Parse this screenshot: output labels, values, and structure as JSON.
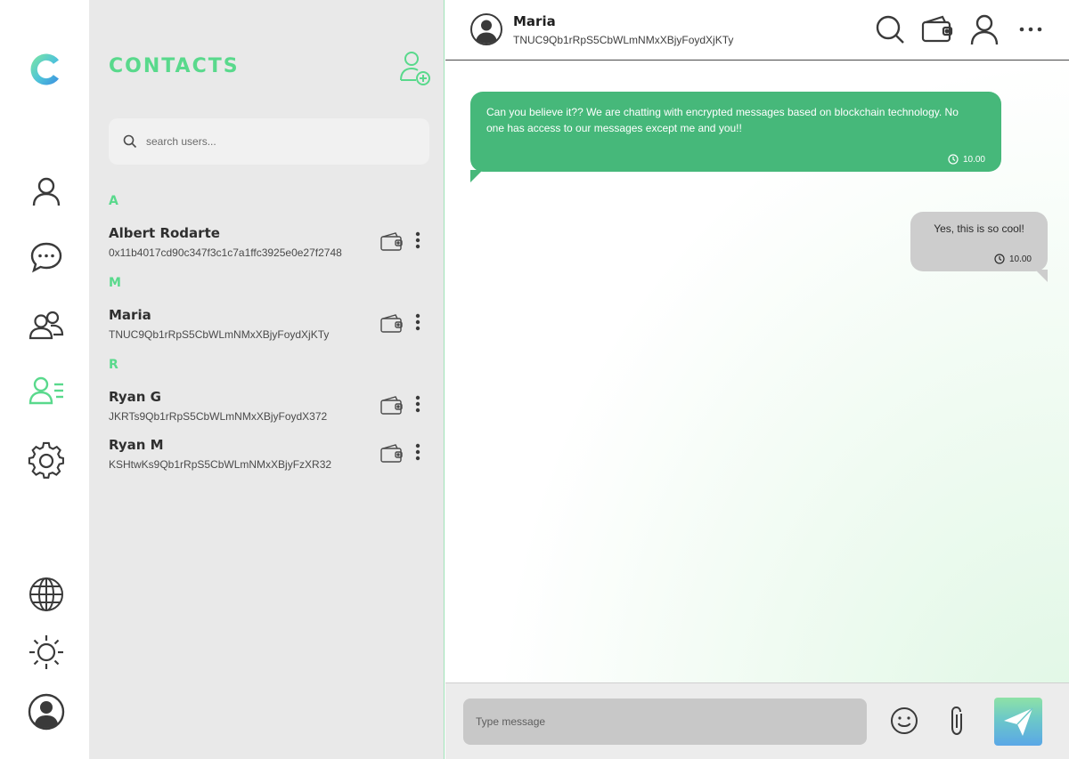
{
  "brand": {
    "logo_icon": "c-logo-icon",
    "accent": "#59d98c",
    "dark_green": "#46b87a"
  },
  "rail": {
    "items": [
      {
        "icon": "user-icon"
      },
      {
        "icon": "chat-bubble-icon"
      },
      {
        "icon": "group-icon"
      },
      {
        "icon": "contacts-list-icon",
        "active": true
      },
      {
        "icon": "gear-icon"
      },
      {
        "icon": "globe-icon"
      },
      {
        "icon": "sun-icon"
      },
      {
        "icon": "profile-avatar-icon"
      }
    ]
  },
  "contacts": {
    "title": "CONTACTS",
    "add_icon": "add-user-icon",
    "search": {
      "placeholder": "search users..."
    },
    "groups": [
      {
        "letter": "A",
        "items": [
          {
            "name": "Albert Rodarte",
            "address": "0x11b4017cd90c347f3c1c7a1ffc3925e0e27f2748"
          }
        ]
      },
      {
        "letter": "M",
        "items": [
          {
            "name": "Maria",
            "address": "TNUC9Qb1rRpS5CbWLmNMxXBjyFoydXjKTy"
          }
        ]
      },
      {
        "letter": "R",
        "items": [
          {
            "name": "Ryan G",
            "address": "JKRTs9Qb1rRpS5CbWLmNMxXBjyFoydX372"
          },
          {
            "name": "Ryan M",
            "address": "KSHtwKs9Qb1rRpS5CbWLmNMxXBjyFzXR32"
          }
        ]
      }
    ]
  },
  "chat": {
    "header": {
      "name": "Maria",
      "address": "TNUC9Qb1rRpS5CbWLmNMxXBjyFoydXjKTy"
    },
    "messages": [
      {
        "direction": "incoming",
        "text": "Can you believe it?? We are chatting with encrypted messages based on blockchain technology. No one has access to our messages except me and you!!",
        "time": "10.00"
      },
      {
        "direction": "outgoing",
        "text": "Yes, this is so cool!",
        "time": "10.00"
      }
    ],
    "composer": {
      "placeholder": "Type message"
    }
  }
}
